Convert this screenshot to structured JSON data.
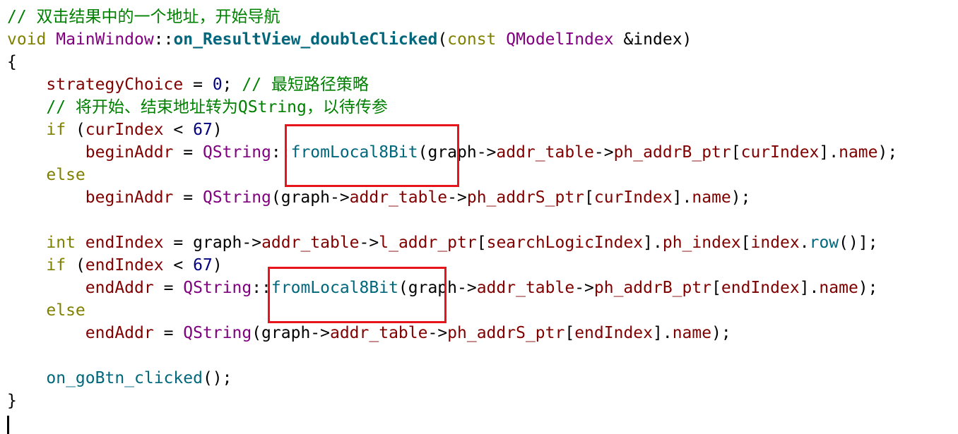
{
  "code_lines": [
    {
      "tokens": [
        {
          "text": "// 双击结果中的一个地址，开始导航",
          "kind": "comment"
        }
      ]
    },
    {
      "tokens": [
        {
          "text": "void",
          "kind": "keyword"
        },
        {
          "text": " ",
          "kind": "plain"
        },
        {
          "text": "MainWindow",
          "kind": "type"
        },
        {
          "text": "::",
          "kind": "plain"
        },
        {
          "text": "on_ResultView_doubleClicked",
          "kind": "bold"
        },
        {
          "text": "(",
          "kind": "plain"
        },
        {
          "text": "const",
          "kind": "keyword"
        },
        {
          "text": " ",
          "kind": "plain"
        },
        {
          "text": "QModelIndex",
          "kind": "type"
        },
        {
          "text": " &index)",
          "kind": "plain"
        }
      ]
    },
    {
      "tokens": [
        {
          "text": "{",
          "kind": "plain"
        }
      ]
    },
    {
      "tokens": [
        {
          "text": "    ",
          "kind": "plain"
        },
        {
          "text": "strategyChoice",
          "kind": "member"
        },
        {
          "text": " = ",
          "kind": "plain"
        },
        {
          "text": "0",
          "kind": "num"
        },
        {
          "text": "; ",
          "kind": "plain"
        },
        {
          "text": "// 最短路径策略",
          "kind": "comment"
        }
      ]
    },
    {
      "tokens": [
        {
          "text": "    ",
          "kind": "plain"
        },
        {
          "text": "// 将开始、结束地址转为QString，以待传参",
          "kind": "comment"
        }
      ]
    },
    {
      "tokens": [
        {
          "text": "    ",
          "kind": "plain"
        },
        {
          "text": "if",
          "kind": "keyword"
        },
        {
          "text": " (",
          "kind": "plain"
        },
        {
          "text": "curIndex",
          "kind": "member"
        },
        {
          "text": " < ",
          "kind": "plain"
        },
        {
          "text": "67",
          "kind": "num"
        },
        {
          "text": ")",
          "kind": "plain"
        }
      ]
    },
    {
      "tokens": [
        {
          "text": "        ",
          "kind": "plain"
        },
        {
          "text": "beginAddr",
          "kind": "member"
        },
        {
          "text": " = ",
          "kind": "plain"
        },
        {
          "text": "QString",
          "kind": "type"
        },
        {
          "text": "::",
          "kind": "plain"
        },
        {
          "text": "fromLocal8Bit",
          "kind": "func"
        },
        {
          "text": "(graph->",
          "kind": "plain"
        },
        {
          "text": "addr_table",
          "kind": "member"
        },
        {
          "text": "->",
          "kind": "plain"
        },
        {
          "text": "ph_addrB_ptr",
          "kind": "member"
        },
        {
          "text": "[",
          "kind": "plain"
        },
        {
          "text": "curIndex",
          "kind": "member"
        },
        {
          "text": "].",
          "kind": "plain"
        },
        {
          "text": "name",
          "kind": "member"
        },
        {
          "text": ");",
          "kind": "plain"
        }
      ]
    },
    {
      "tokens": [
        {
          "text": "    ",
          "kind": "plain"
        },
        {
          "text": "else",
          "kind": "keyword"
        }
      ]
    },
    {
      "tokens": [
        {
          "text": "        ",
          "kind": "plain"
        },
        {
          "text": "beginAddr",
          "kind": "member"
        },
        {
          "text": " = ",
          "kind": "plain"
        },
        {
          "text": "QString",
          "kind": "type"
        },
        {
          "text": "(graph->",
          "kind": "plain"
        },
        {
          "text": "addr_table",
          "kind": "member"
        },
        {
          "text": "->",
          "kind": "plain"
        },
        {
          "text": "ph_addrS_ptr",
          "kind": "member"
        },
        {
          "text": "[",
          "kind": "plain"
        },
        {
          "text": "curIndex",
          "kind": "member"
        },
        {
          "text": "].",
          "kind": "plain"
        },
        {
          "text": "name",
          "kind": "member"
        },
        {
          "text": ");",
          "kind": "plain"
        }
      ]
    },
    {
      "tokens": []
    },
    {
      "tokens": [
        {
          "text": "    ",
          "kind": "plain"
        },
        {
          "text": "int",
          "kind": "keyword"
        },
        {
          "text": " ",
          "kind": "plain"
        },
        {
          "text": "endIndex",
          "kind": "member"
        },
        {
          "text": " = graph->",
          "kind": "plain"
        },
        {
          "text": "addr_table",
          "kind": "member"
        },
        {
          "text": "->",
          "kind": "plain"
        },
        {
          "text": "l_addr_ptr",
          "kind": "member"
        },
        {
          "text": "[",
          "kind": "plain"
        },
        {
          "text": "searchLogicIndex",
          "kind": "member"
        },
        {
          "text": "].",
          "kind": "plain"
        },
        {
          "text": "ph_index",
          "kind": "member"
        },
        {
          "text": "[",
          "kind": "plain"
        },
        {
          "text": "index",
          "kind": "member"
        },
        {
          "text": ".",
          "kind": "plain"
        },
        {
          "text": "row",
          "kind": "func"
        },
        {
          "text": "()];",
          "kind": "plain"
        }
      ]
    },
    {
      "tokens": [
        {
          "text": "    ",
          "kind": "plain"
        },
        {
          "text": "if",
          "kind": "keyword"
        },
        {
          "text": " (",
          "kind": "plain"
        },
        {
          "text": "endIndex",
          "kind": "member"
        },
        {
          "text": " < ",
          "kind": "plain"
        },
        {
          "text": "67",
          "kind": "num"
        },
        {
          "text": ")",
          "kind": "plain"
        }
      ]
    },
    {
      "tokens": [
        {
          "text": "        ",
          "kind": "plain"
        },
        {
          "text": "endAddr",
          "kind": "member"
        },
        {
          "text": " = ",
          "kind": "plain"
        },
        {
          "text": "QString",
          "kind": "type"
        },
        {
          "text": "::",
          "kind": "plain"
        },
        {
          "text": "fromLocal8Bit",
          "kind": "func"
        },
        {
          "text": "(graph->",
          "kind": "plain"
        },
        {
          "text": "addr_table",
          "kind": "member"
        },
        {
          "text": "->",
          "kind": "plain"
        },
        {
          "text": "ph_addrB_ptr",
          "kind": "member"
        },
        {
          "text": "[",
          "kind": "plain"
        },
        {
          "text": "endIndex",
          "kind": "member"
        },
        {
          "text": "].",
          "kind": "plain"
        },
        {
          "text": "name",
          "kind": "member"
        },
        {
          "text": ");",
          "kind": "plain"
        }
      ]
    },
    {
      "tokens": [
        {
          "text": "    ",
          "kind": "plain"
        },
        {
          "text": "else",
          "kind": "keyword"
        }
      ]
    },
    {
      "tokens": [
        {
          "text": "        ",
          "kind": "plain"
        },
        {
          "text": "endAddr",
          "kind": "member"
        },
        {
          "text": " = ",
          "kind": "plain"
        },
        {
          "text": "QString",
          "kind": "type"
        },
        {
          "text": "(graph->",
          "kind": "plain"
        },
        {
          "text": "addr_table",
          "kind": "member"
        },
        {
          "text": "->",
          "kind": "plain"
        },
        {
          "text": "ph_addrS_ptr",
          "kind": "member"
        },
        {
          "text": "[",
          "kind": "plain"
        },
        {
          "text": "endIndex",
          "kind": "member"
        },
        {
          "text": "].",
          "kind": "plain"
        },
        {
          "text": "name",
          "kind": "member"
        },
        {
          "text": ");",
          "kind": "plain"
        }
      ]
    },
    {
      "tokens": []
    },
    {
      "tokens": [
        {
          "text": "    ",
          "kind": "plain"
        },
        {
          "text": "on_goBtn_clicked",
          "kind": "func"
        },
        {
          "text": "();",
          "kind": "plain"
        }
      ]
    },
    {
      "tokens": [
        {
          "text": "}",
          "kind": "plain"
        }
      ]
    }
  ],
  "highlight_color": "#e8141c"
}
